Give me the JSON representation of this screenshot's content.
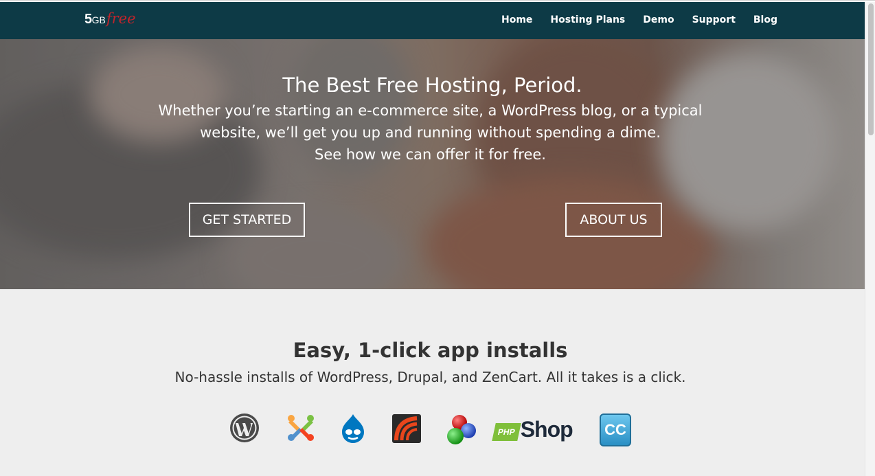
{
  "brand": {
    "number": "5",
    "unit": "GB",
    "script": "free"
  },
  "nav": {
    "items": [
      {
        "label": "Home"
      },
      {
        "label": "Hosting Plans"
      },
      {
        "label": "Demo"
      },
      {
        "label": "Support"
      },
      {
        "label": "Blog"
      }
    ]
  },
  "hero": {
    "title": "The Best Free Hosting, Period.",
    "subtitle_line1": "Whether you’re starting an e-commerce site, a WordPress blog, or a typical",
    "subtitle_line2": "website, we’ll get you up and running without spending a dime.",
    "subtitle_line3": "See how we can offer it for free.",
    "primary_button": "GET STARTED",
    "secondary_button": "ABOUT US"
  },
  "apps": {
    "title": "Easy, 1-click app installs",
    "subtitle": "No-hassle installs of WordPress, Drupal, and ZenCart. All it takes is a click.",
    "icons": [
      {
        "name": "wordpress-icon"
      },
      {
        "name": "joomla-icon"
      },
      {
        "name": "drupal-icon"
      },
      {
        "name": "zencart-icon"
      },
      {
        "name": "oscommerce-icon"
      },
      {
        "name": "phpshop-icon",
        "text_badge": "PHP",
        "text_word": "Shop"
      },
      {
        "name": "concrete-cms-icon",
        "text": "CC"
      }
    ]
  },
  "colors": {
    "navbar": "#0d3a46",
    "brand_red": "#c0242b",
    "section_bg": "#eeeeee"
  }
}
